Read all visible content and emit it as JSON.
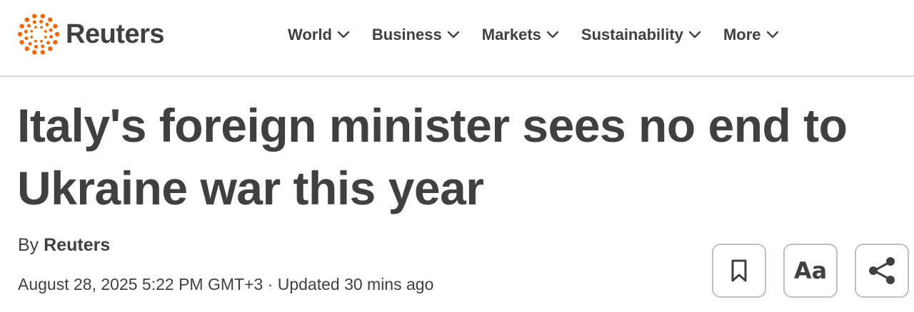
{
  "brand": {
    "name": "Reuters",
    "accent_color": "#fa6400",
    "logo_icon": "reuters-dot-ring-logo"
  },
  "nav": {
    "items": [
      {
        "label": "World",
        "icon": "chevron-down-icon"
      },
      {
        "label": "Business",
        "icon": "chevron-down-icon"
      },
      {
        "label": "Markets",
        "icon": "chevron-down-icon"
      },
      {
        "label": "Sustainability",
        "icon": "chevron-down-icon"
      },
      {
        "label": "More",
        "icon": "chevron-down-icon"
      }
    ]
  },
  "article": {
    "headline": "Italy's foreign minister sees no end to Ukraine war this year",
    "byline_prefix": "By",
    "byline_author": "Reuters",
    "dateline": "August 28, 2025 5:22 PM GMT+3 · Updated 30 mins ago"
  },
  "actions": {
    "bookmark_icon": "bookmark-icon",
    "text_size_label": "Aa",
    "share_icon": "share-icon"
  }
}
